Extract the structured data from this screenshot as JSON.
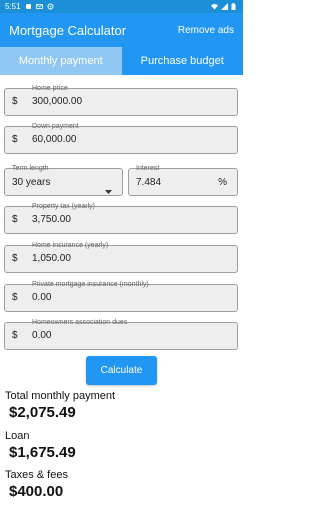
{
  "status_bar": {
    "time": "5:51",
    "icons": [
      "notification-icon",
      "email-icon",
      "gear-icon",
      "wifi-icon",
      "signal-icon",
      "battery-icon"
    ]
  },
  "app_bar": {
    "title": "Mortgage Calculator",
    "remove_ads": "Remove ads"
  },
  "tabs": [
    {
      "label": "Monthly payment",
      "active": true
    },
    {
      "label": "Purchase budget",
      "active": false
    }
  ],
  "fields": {
    "home_price": {
      "label": "Home price",
      "prefix": "$",
      "value": "300,000.00"
    },
    "down_payment": {
      "label": "Down payment",
      "prefix": "$",
      "value": "60,000.00"
    },
    "term_length": {
      "label": "Term length",
      "value": "30 years"
    },
    "interest": {
      "label": "Interest",
      "value": "7.484",
      "suffix": "%"
    },
    "property_tax": {
      "label": "Property tax (yearly)",
      "prefix": "$",
      "value": "3,750.00"
    },
    "home_insurance": {
      "label": "Home insurance (yearly)",
      "prefix": "$",
      "value": "1,050.00"
    },
    "pmi": {
      "label": "Private mortgage insurance (monthly)",
      "prefix": "$",
      "value": "0.00"
    },
    "hoa": {
      "label": "Homeowners association dues",
      "prefix": "$",
      "value": "0.00"
    }
  },
  "calculate_label": "Calculate",
  "results": {
    "total_label": "Total monthly payment",
    "total_value": "$2,075.49",
    "loan_label": "Loan",
    "loan_value": "$1,675.49",
    "taxes_label": "Taxes & fees",
    "taxes_value": "$400.00"
  },
  "colors": {
    "primary": "#2196f3",
    "status_bar": "#1d8fd8",
    "active_tab": "#90c8f3",
    "field_bg": "#eeeeee"
  }
}
